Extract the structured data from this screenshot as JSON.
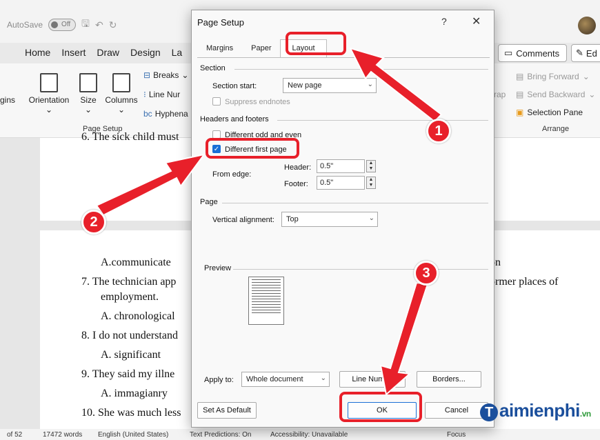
{
  "titlebar": {
    "autosave_label": "AutoSave",
    "autosave_state": "Off"
  },
  "ribbon_tabs": [
    "Home",
    "Insert",
    "Draw",
    "Design",
    "La"
  ],
  "header_buttons": {
    "comments": "Comments",
    "edit": "Ed"
  },
  "ribbon": {
    "margins": "gins",
    "orientation": "Orientation",
    "size": "Size",
    "columns": "Columns",
    "breaks": "Breaks",
    "line_numbers": "Line Nur",
    "hyphenation": "Hyphena",
    "page_setup_group": "Page Setup",
    "bring_forward": "Bring Forward",
    "send_backward": "Send Backward",
    "selection_pane": "Selection Pane",
    "arrange_group": "Arrange",
    "wrap": "rap"
  },
  "document": {
    "lines": [
      "6.   The sick child must",
      "A.communicate",
      "on",
      "7.   The technician app",
      "ormer places of",
      "employment.",
      "A. chronological",
      "8.   I do not understand",
      "A. significant",
      "9.   They said my illne",
      "A. immagianry",
      "10. She was much less"
    ]
  },
  "statusbar": {
    "page": "of 52",
    "words": "17472 words",
    "language": "English (United States)",
    "predictions": "Text Predictions: On",
    "accessibility": "Accessibility: Unavailable",
    "focus": "Focus"
  },
  "dialog": {
    "title": "Page Setup",
    "help": "?",
    "close": "✕",
    "tabs": [
      "Margins",
      "Paper",
      "Layout"
    ],
    "active_tab": "Layout",
    "section_heading": "Section",
    "section_start_label": "Section start:",
    "section_start_value": "New page",
    "suppress_endnotes": "Suppress endnotes",
    "headers_footers_heading": "Headers and footers",
    "different_odd_even": "Different odd and even",
    "different_first_page": "Different first page",
    "from_edge_label": "From edge:",
    "header_label": "Header:",
    "header_value": "0.5\"",
    "footer_label": "Footer:",
    "footer_value": "0.5\"",
    "page_heading": "Page",
    "vertical_alignment_label": "Vertical alignment:",
    "vertical_alignment_value": "Top",
    "preview_heading": "Preview",
    "apply_to_label": "Apply to:",
    "apply_to_value": "Whole document",
    "line_numbers_button": "Line Numbe",
    "borders_button": "Borders...",
    "set_default_button": "Set As Default",
    "ok_button": "OK",
    "cancel_button": "Cancel"
  },
  "annotations": {
    "markers": [
      "1",
      "2",
      "3"
    ],
    "color": "#e8202a"
  },
  "watermark": {
    "brand": "aimienphi",
    "tld": ".vn"
  }
}
